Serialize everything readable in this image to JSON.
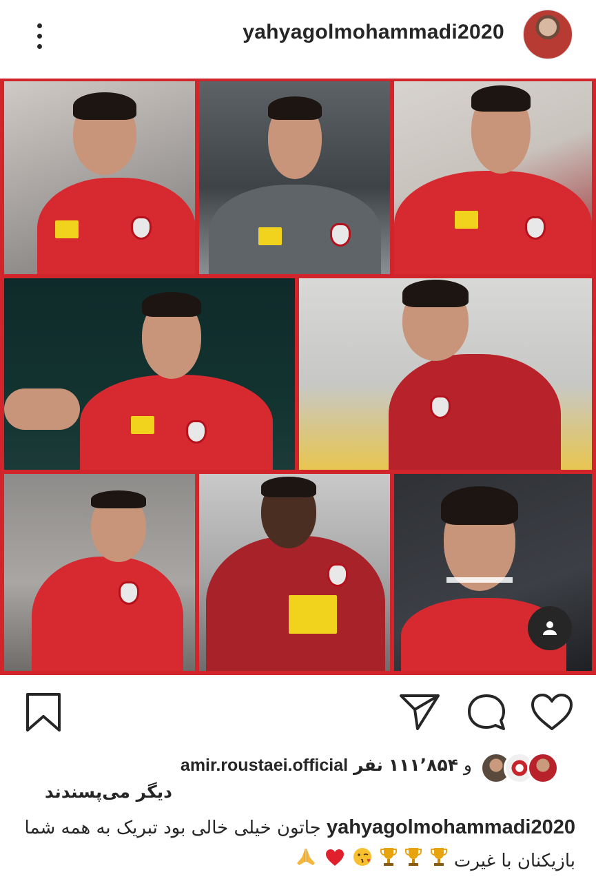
{
  "header": {
    "username": "yahyagolmohammadi2020",
    "menu_icon": "more-vertical-icon",
    "avatar_icon": "profile-avatar"
  },
  "post": {
    "tiles": [
      {
        "player": "player-1",
        "kit": "red"
      },
      {
        "player": "player-2",
        "kit": "gray"
      },
      {
        "player": "player-3",
        "kit": "red"
      },
      {
        "player": "player-4",
        "kit": "red"
      },
      {
        "player": "player-5",
        "kit": "dark-red"
      },
      {
        "player": "player-6",
        "kit": "red"
      },
      {
        "player": "player-7",
        "kit": "dark-red"
      },
      {
        "player": "player-8",
        "kit": "red"
      }
    ],
    "user_tag_icon": "person-icon",
    "colors": {
      "frame": "#d1242b",
      "kit_red": "#d62a30",
      "kit_dark": "#8f1c22"
    }
  },
  "actions": {
    "save_icon": "bookmark-icon",
    "share_icon": "send-icon",
    "comment_icon": "comment-icon",
    "like_icon": "heart-icon"
  },
  "likes": {
    "conjunction": "و",
    "count": "۱۱۱٬۸۵۴",
    "unit": "نفر",
    "user": "amir.roustaei.official",
    "line2": "دیگر می‌پسندند"
  },
  "caption": {
    "user": "yahyagolmohammadi2020",
    "text": " جاتون خیلی خالی بود تبریک به همه شما بازیکنان با غیرت ",
    "emojis": [
      "trophy-emoji",
      "trophy-emoji",
      "trophy-emoji",
      "kiss-emoji",
      "red-heart-emoji",
      "folded-hands-emoji"
    ]
  }
}
